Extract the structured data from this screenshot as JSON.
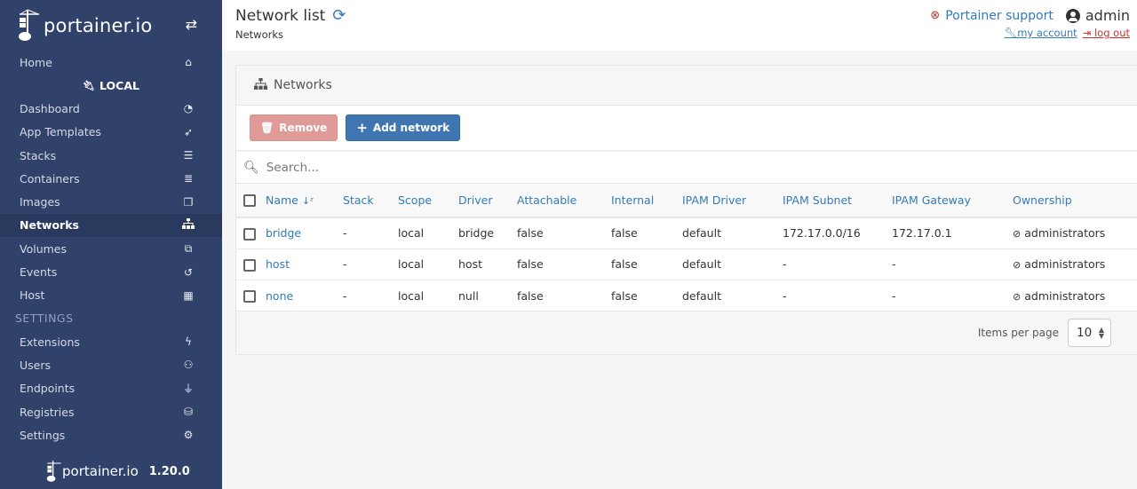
{
  "sidebar": {
    "brand": "portainer.io",
    "toggle_icon": "exchange-icon",
    "home": {
      "label": "Home",
      "icon": "home-icon"
    },
    "endpoint": {
      "label": "LOCAL",
      "icon": "plug-icon"
    },
    "items": [
      {
        "label": "Dashboard",
        "icon": "tachometer-icon"
      },
      {
        "label": "App Templates",
        "icon": "rocket-icon"
      },
      {
        "label": "Stacks",
        "icon": "th-list-icon"
      },
      {
        "label": "Containers",
        "icon": "server-icon"
      },
      {
        "label": "Images",
        "icon": "clone-icon"
      },
      {
        "label": "Networks",
        "icon": "sitemap-icon",
        "active": true
      },
      {
        "label": "Volumes",
        "icon": "cubes-icon"
      },
      {
        "label": "Events",
        "icon": "history-icon"
      },
      {
        "label": "Host",
        "icon": "th-icon"
      }
    ],
    "settings_section": "SETTINGS",
    "settings_items": [
      {
        "label": "Extensions",
        "icon": "bolt-icon"
      },
      {
        "label": "Users",
        "icon": "users-icon"
      },
      {
        "label": "Endpoints",
        "icon": "plug-icon"
      },
      {
        "label": "Registries",
        "icon": "database-icon"
      },
      {
        "label": "Settings",
        "icon": "cogs-icon"
      }
    ],
    "footer": {
      "brand": "portainer.io",
      "version": "1.20.0"
    }
  },
  "header": {
    "title": "Network list",
    "breadcrumb": "Networks",
    "support_label": "Portainer support",
    "username": "admin",
    "my_account": "my account",
    "log_out": "log out"
  },
  "widget": {
    "title": "Networks",
    "remove_label": "Remove",
    "add_label": "Add network",
    "search_placeholder": "Search...",
    "columns": [
      "Name",
      "Stack",
      "Scope",
      "Driver",
      "Attachable",
      "Internal",
      "IPAM Driver",
      "IPAM Subnet",
      "IPAM Gateway",
      "Ownership"
    ],
    "rows": [
      {
        "name": "bridge",
        "stack": "-",
        "scope": "local",
        "driver": "bridge",
        "attachable": "false",
        "internal": "false",
        "ipam_driver": "default",
        "ipam_subnet": "172.17.0.0/16",
        "ipam_gateway": "172.17.0.1",
        "ownership": "administrators"
      },
      {
        "name": "host",
        "stack": "-",
        "scope": "local",
        "driver": "host",
        "attachable": "false",
        "internal": "false",
        "ipam_driver": "default",
        "ipam_subnet": "-",
        "ipam_gateway": "-",
        "ownership": "administrators"
      },
      {
        "name": "none",
        "stack": "-",
        "scope": "local",
        "driver": "null",
        "attachable": "false",
        "internal": "false",
        "ipam_driver": "default",
        "ipam_subnet": "-",
        "ipam_gateway": "-",
        "ownership": "administrators"
      }
    ],
    "items_per_page_label": "Items per page",
    "items_per_page_value": "10"
  },
  "colors": {
    "sidebar_bg": "#30426a",
    "primary": "#337ab7",
    "danger": "#c9302c"
  }
}
